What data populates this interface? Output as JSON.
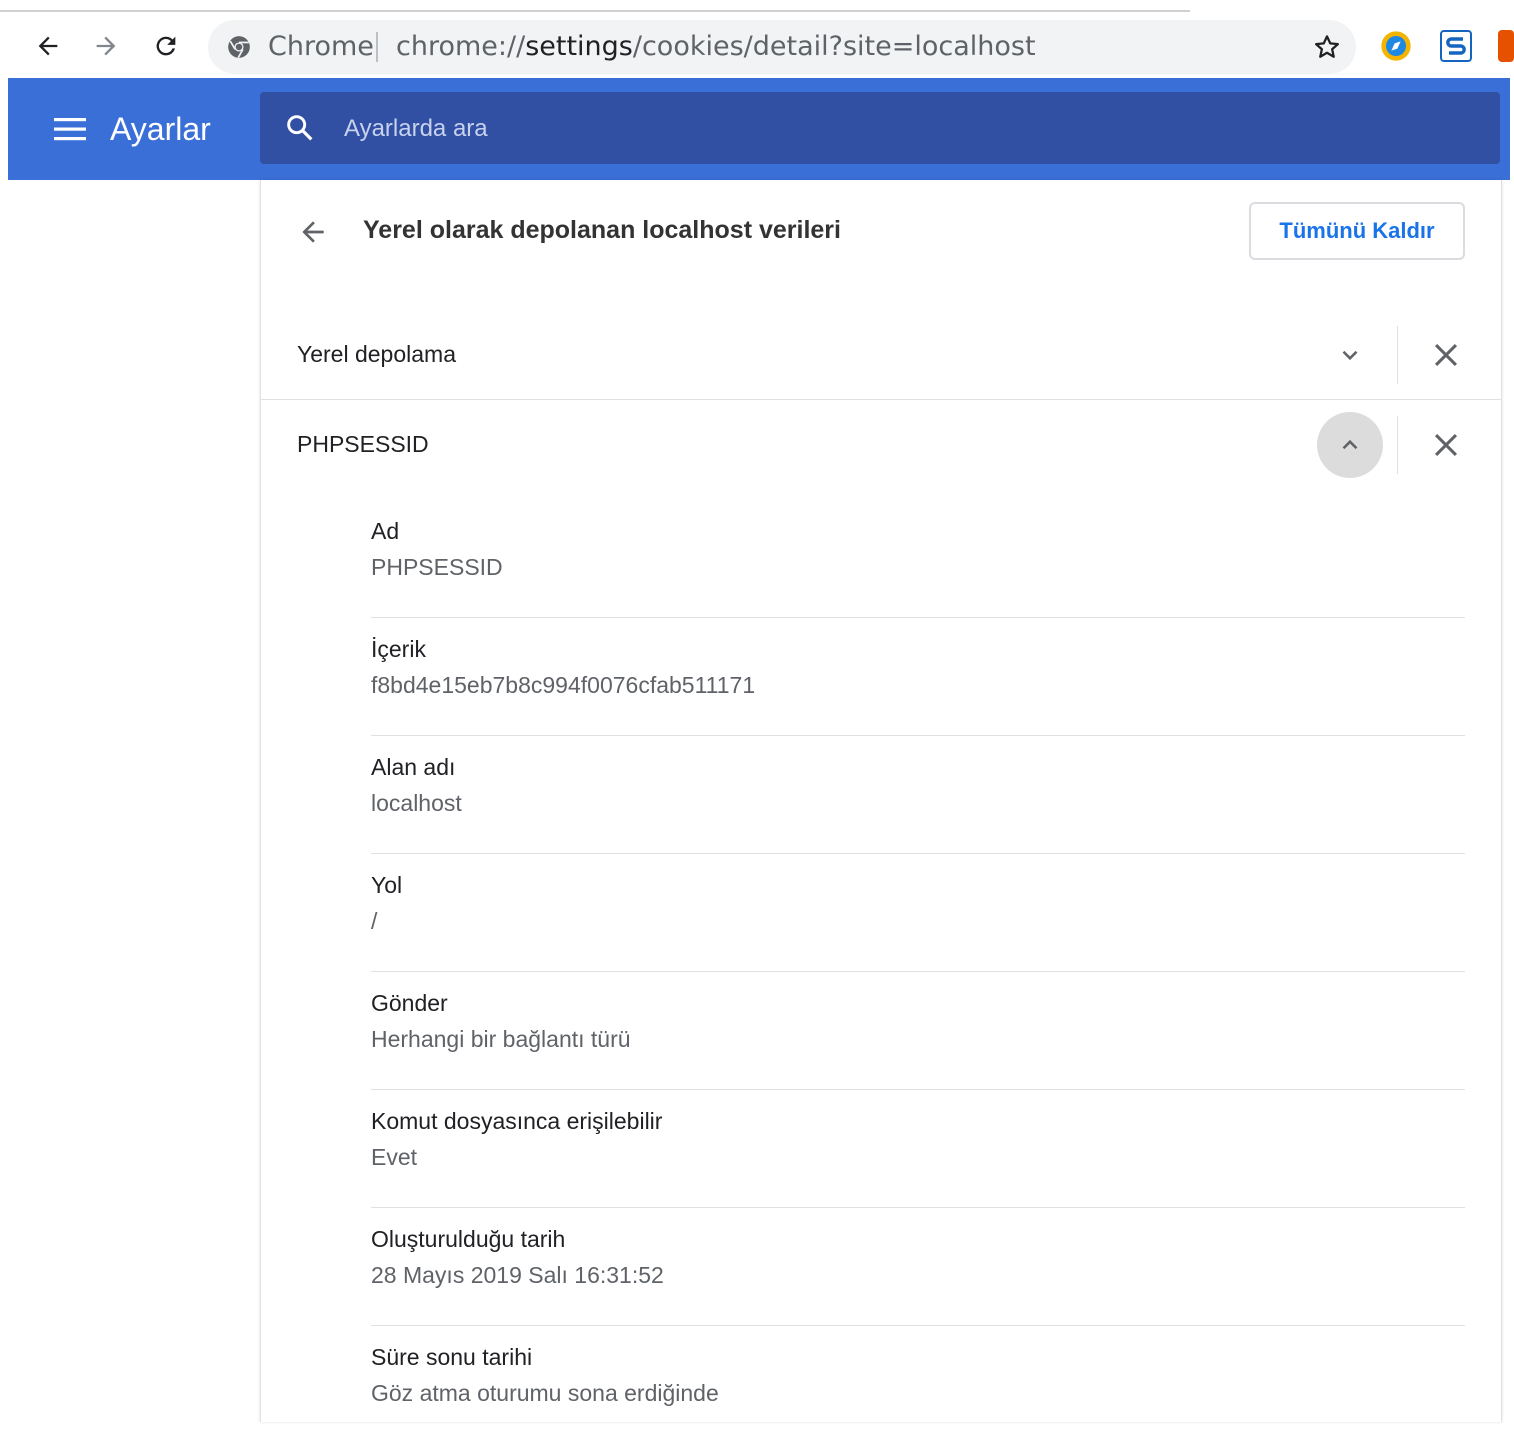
{
  "browser": {
    "chip_label": "Chrome",
    "url_scheme": "chrome://",
    "url_host": "settings",
    "url_path": "/cookies/detail?site=localhost",
    "extension_colors": [
      "#f4b400",
      "#1565c0",
      "#e65100"
    ]
  },
  "header": {
    "title": "Ayarlar",
    "search_placeholder": "Ayarlarda ara",
    "background_color": "#3b6fd8"
  },
  "page": {
    "title": "Yerel olarak depolanan localhost verileri",
    "remove_all_label": "Tümünü Kaldır"
  },
  "rows": [
    {
      "label": "Yerel depolama",
      "expanded": false
    },
    {
      "label": "PHPSESSID",
      "expanded": true
    }
  ],
  "details": [
    {
      "label": "Ad",
      "value": "PHPSESSID"
    },
    {
      "label": "İçerik",
      "value": "f8bd4e15eb7b8c994f0076cfab511171"
    },
    {
      "label": "Alan adı",
      "value": "localhost"
    },
    {
      "label": "Yol",
      "value": "/"
    },
    {
      "label": "Gönder",
      "value": "Herhangi bir bağlantı türü"
    },
    {
      "label": "Komut dosyasınca erişilebilir",
      "value": "Evet"
    },
    {
      "label": "Oluşturulduğu tarih",
      "value": "28 Mayıs 2019 Salı 16:31:52"
    },
    {
      "label": "Süre sonu tarihi",
      "value": "Göz atma oturumu sona erdiğinde"
    }
  ],
  "icons": {
    "back": "arrow-left-icon",
    "forward": "arrow-right-icon",
    "reload": "reload-icon",
    "site_info": "chrome-logo-icon",
    "bookmark": "star-icon",
    "menu": "hamburger-menu-icon",
    "search": "search-icon",
    "expand": "chevron-down-icon",
    "collapse": "chevron-up-icon",
    "remove": "close-icon"
  }
}
